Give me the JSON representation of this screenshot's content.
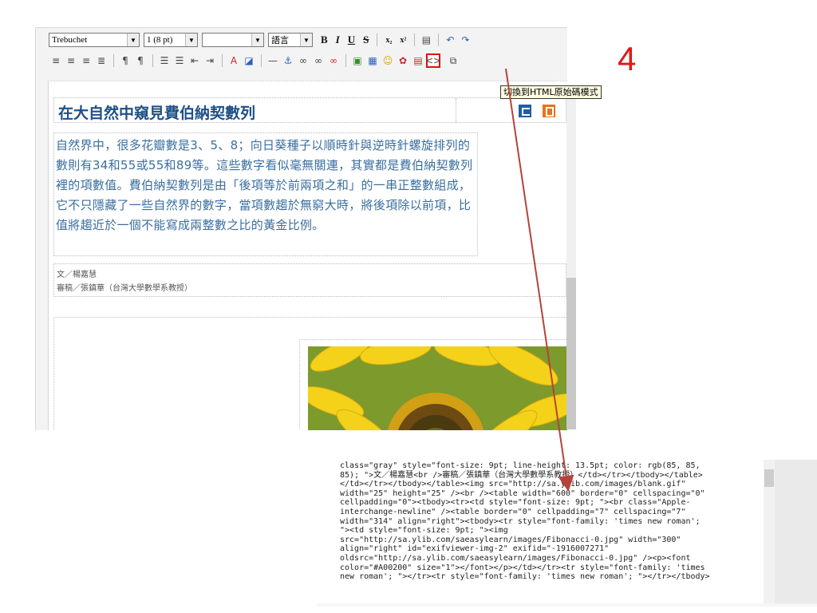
{
  "toolbar": {
    "font_family": "Trebuchet",
    "font_size": "1 (8 pt)",
    "style_value": "",
    "language_label": "語言",
    "bold": "B",
    "italic": "I",
    "underline": "U",
    "strike": "S",
    "subscript": "x₂",
    "superscript": "x²",
    "icons_row1": [
      "list-icon",
      "undo-icon",
      "redo-icon"
    ],
    "icons_row2": [
      "align-left-icon",
      "align-center-icon",
      "align-right-icon",
      "align-justify-icon",
      "ltr-icon",
      "rtl-icon",
      "ordered-list-icon",
      "unordered-list-icon",
      "outdent-icon",
      "indent-icon",
      "text-color-icon",
      "background-color-icon",
      "horizontal-rule-icon",
      "anchor-icon",
      "link-icon",
      "unlink-icon",
      "break-link-icon",
      "image-icon",
      "table-icon",
      "smiley-icon",
      "special-char-icon",
      "paste-word-icon",
      "html-source-icon",
      "fullscreen-icon"
    ]
  },
  "tooltip": "切換到HTML原始碼模式",
  "step_number": "4",
  "article": {
    "title": "在大自然中窺見費伯納契數列",
    "summary": "自然界中，很多花瓣數是3、5、8；向日葵種子以順時針與逆時針螺旋排列的數則有34和55或55和89等。這些數字看似毫無關連，其實都是費伯納契數列裡的項數值。費伯納契數列是由「後項等於前兩項之和」的一串正整數組成，它不只隱藏了一些自然界的數字，當項數趨於無窮大時，將後項除以前項，比值將趨近於一個不能寫成兩整數之比的黃金比例。",
    "byline_author": "文／楊嘉慧",
    "byline_reviewer": "審稿／張鎮華（台灣大學數學系教授）"
  },
  "source_code": [
    "class=\"gray\" style=\"font-size: 9pt; line-height: 13.5pt; color: rgb(85, 85,",
    "85); \">文／楊嘉慧<br />審稿／張鎮華（台灣大學數學系教授）</td></tr></tbody></table>",
    "</td></tr></tbody></table><img src=\"http://sa.ylib.com/images/blank.gif\"",
    "width=\"25\" height=\"25\" /><br /><table width=\"600\" border=\"0\" cellspacing=\"0\"",
    "cellpadding=\"0\"><tbody><tr><td style=\"font-size: 9pt; \"><br class=\"Apple-",
    "interchange-newline\" /><table border=\"0\" cellpadding=\"7\" cellspacing=\"7\"",
    "width=\"314\" align=\"right\"><tbody><tr style=\"font-family: 'times new roman';",
    "\"><td style=\"font-size: 9pt; \"><img",
    "src=\"http://sa.ylib.com/saeasylearn/images/Fibonacci-0.jpg\" width=\"300\"",
    "align=\"right\" id=\"exifviewer-img-2\" exifid=\"-1916007271\"",
    "oldsrc=\"http://sa.ylib.com/saeasylearn/images/Fibonacci-0.jpg\" /><p><font",
    "color=\"#A00200\" size=\"1\"></font></p></td></tr><tr style=\"font-family: 'times",
    "new roman'; \"></tr><tr style=\"font-family: 'times new roman'; \"></tr></tbody>"
  ],
  "colors": {
    "accent_red": "#e01818",
    "title_blue": "#1f4f86",
    "summary_blue": "#3a6e9f"
  }
}
